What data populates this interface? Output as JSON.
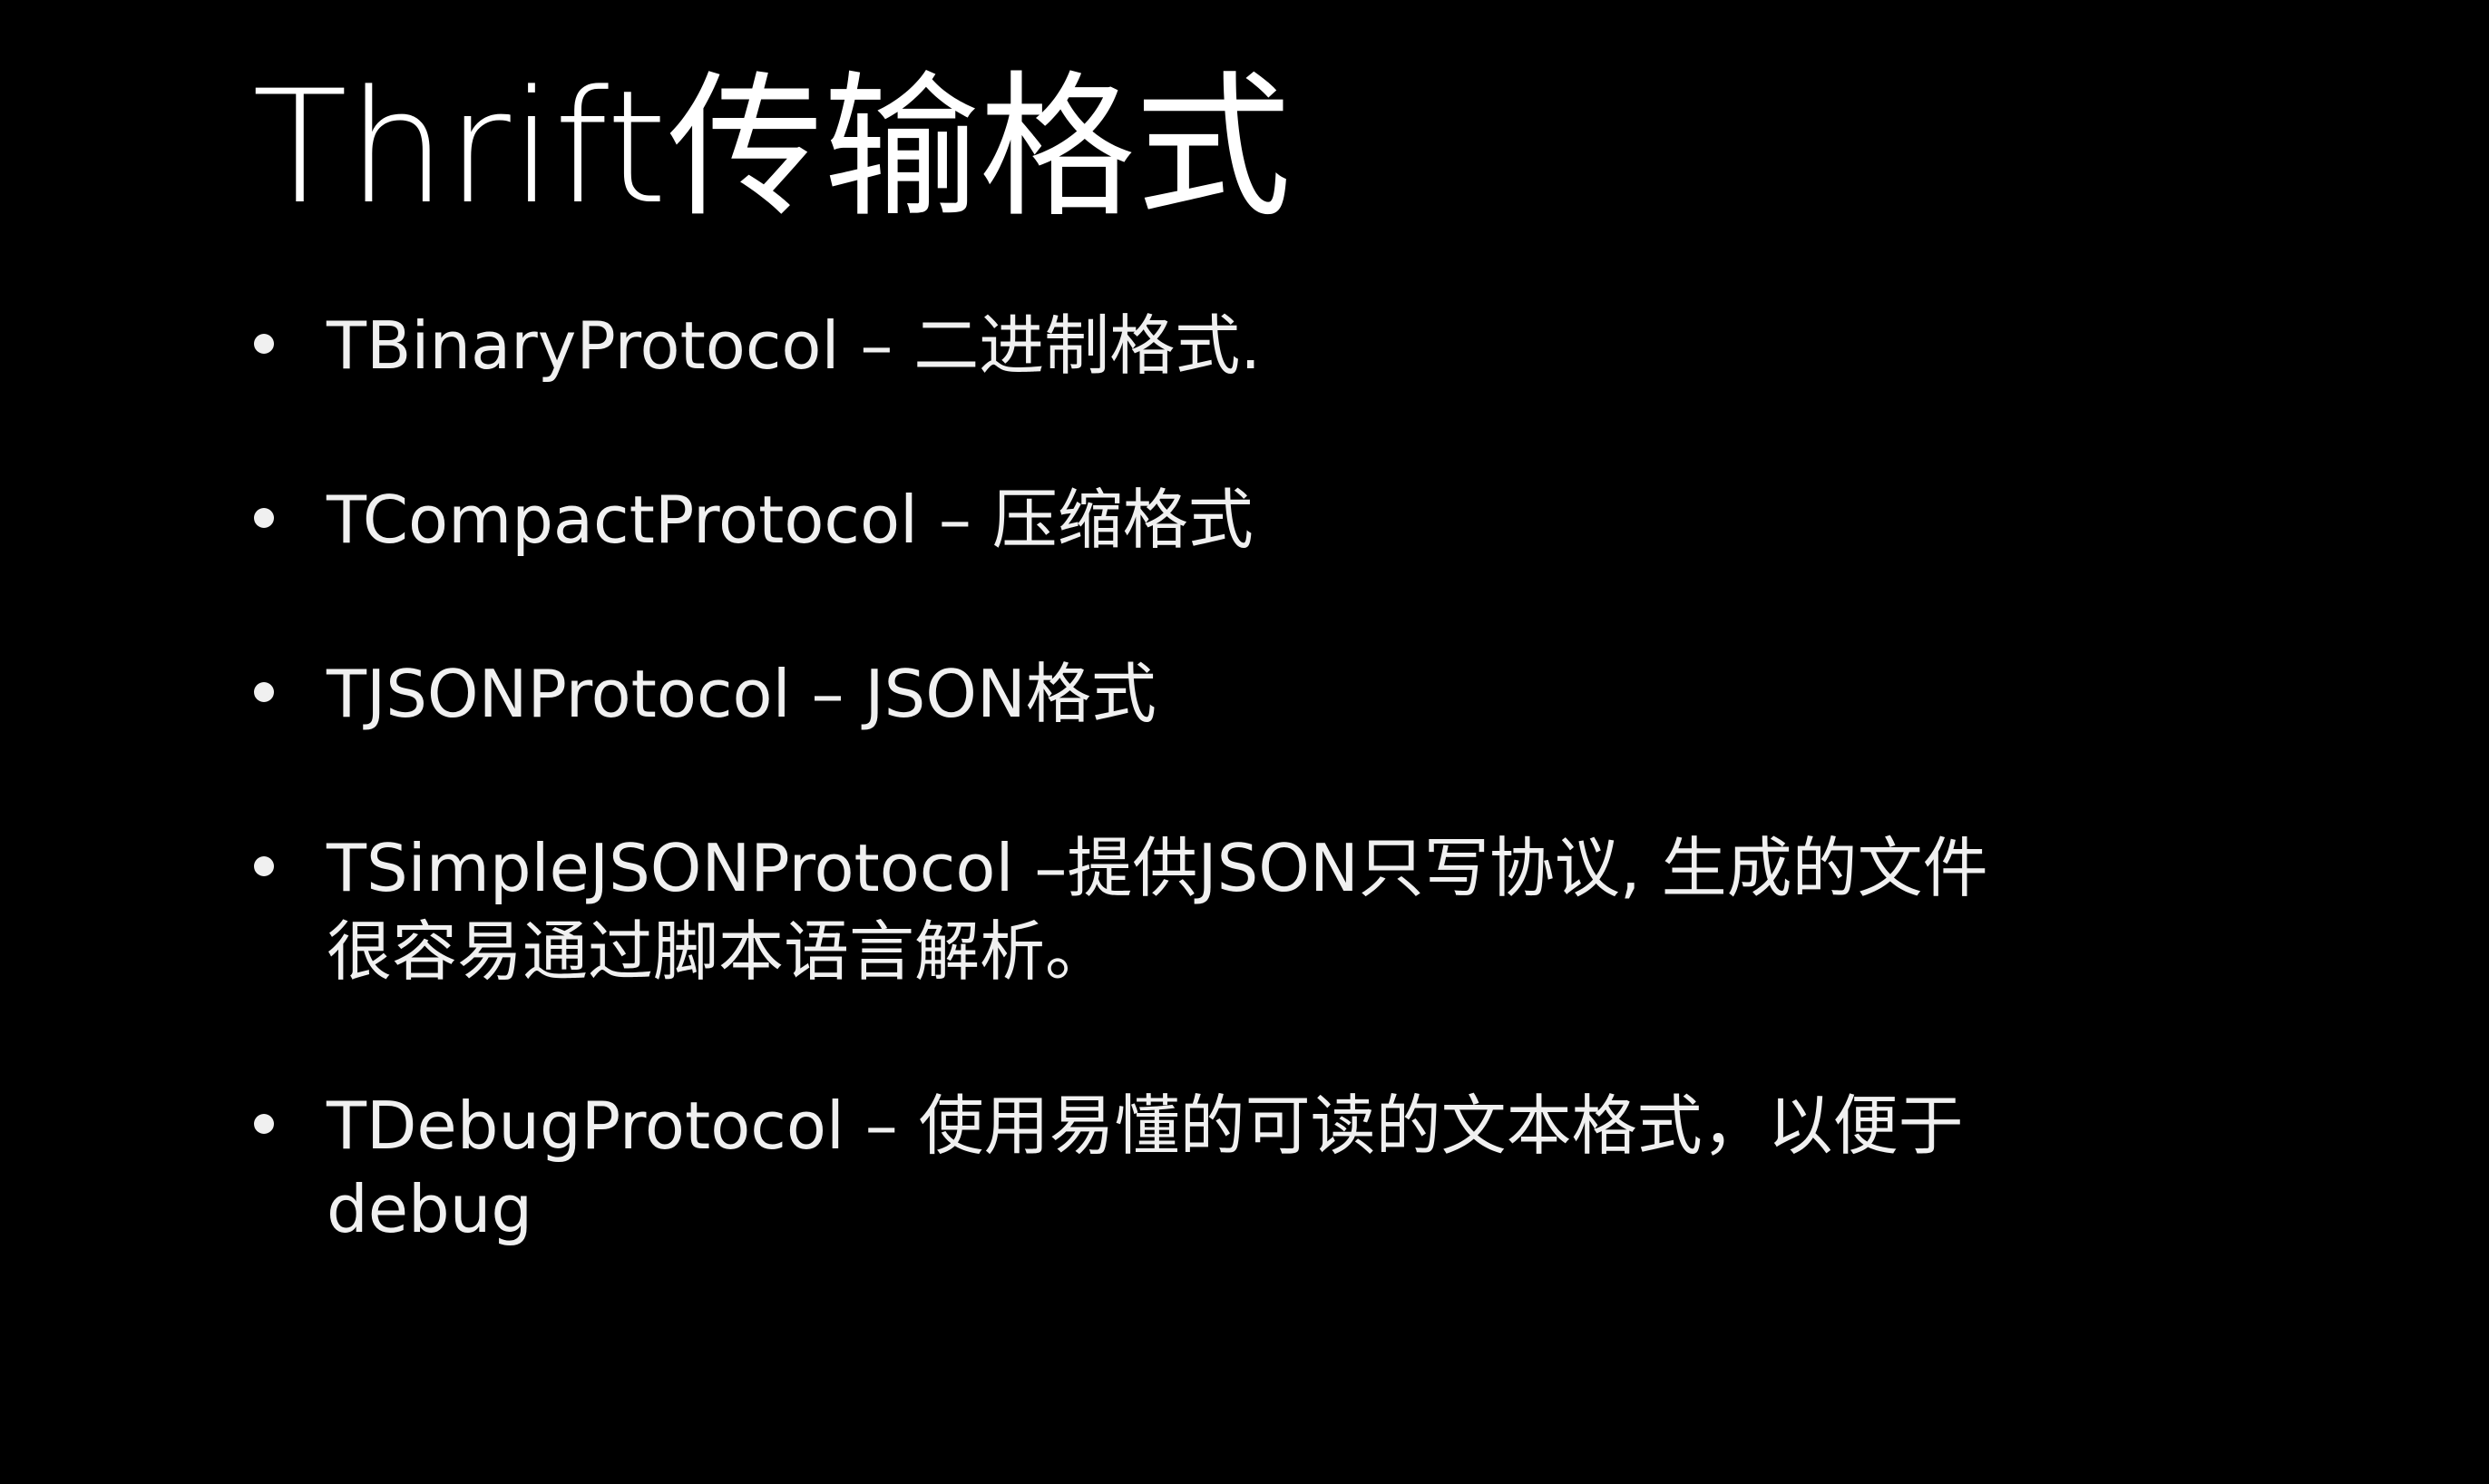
{
  "slide": {
    "title": "Thrift传输格式",
    "bullets": [
      {
        "text": "TBinaryProtocol – 二进制格式."
      },
      {
        "text": "TCompactProtocol – 压缩格式"
      },
      {
        "text": "TJSONProtocol – JSON格式"
      },
      {
        "text": "TSimpleJSONProtocol –提供JSON只写协议, 生成的文件\n很容易通过脚本语言解析。"
      },
      {
        "text": "TDebugProtocol – 使用易懂的可读的文本格式，以便于\ndebug"
      }
    ]
  },
  "colors": {
    "background": "#000000",
    "text": "#ffffff"
  }
}
